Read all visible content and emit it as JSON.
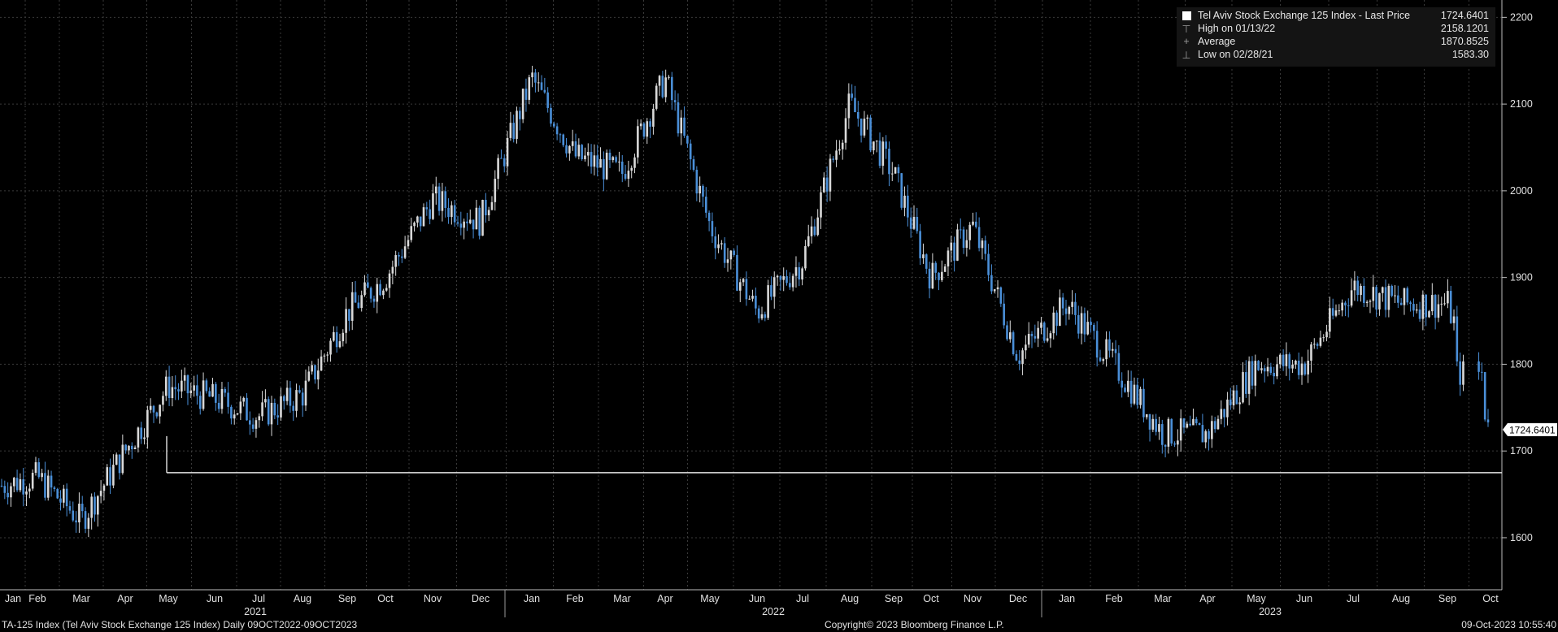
{
  "chart_data": {
    "type": "candlestick",
    "title": "TA-125 Index (Tel Aviv Stock Exchange 125 Index)",
    "frequency": "Daily",
    "date_range": "09OCT2022-09OCT2023",
    "ylim": [
      1540,
      2220
    ],
    "yticks": [
      1600,
      1700,
      1800,
      1900,
      2000,
      2100,
      2200
    ],
    "grid": true,
    "x_months": [
      "Jan",
      "Feb",
      "Mar",
      "Apr",
      "May",
      "Jun",
      "Jul",
      "Aug",
      "Sep",
      "Oct",
      "Nov",
      "Dec",
      "Jan",
      "Feb",
      "Mar",
      "Apr",
      "May",
      "Jun",
      "Jul",
      "Aug",
      "Sep",
      "Oct",
      "Nov",
      "Dec",
      "Jan",
      "Feb",
      "Mar",
      "Apr",
      "May",
      "Jun",
      "Jul",
      "Aug",
      "Sep",
      "Oct"
    ],
    "x_years": [
      "2021",
      "2022",
      "2023"
    ],
    "series": [
      {
        "name": "Tel Aviv Stock Exchange 125 Index - Last Price",
        "last_value": 1724.6401,
        "last_label": "1724.6401",
        "monthly_path": [
          [
            "Jan 2021",
            1660
          ],
          [
            "Feb 2021",
            1670
          ],
          [
            "Mar 2021",
            1620
          ],
          [
            "Apr 2021",
            1700
          ],
          [
            "May 2021",
            1775
          ],
          [
            "Jun 2021",
            1760
          ],
          [
            "Jul 2021",
            1740
          ],
          [
            "Aug 2021",
            1765
          ],
          [
            "Sep 2021",
            1860
          ],
          [
            "Oct 2021",
            1900
          ],
          [
            "Nov 2021",
            1990
          ],
          [
            "Dec 2021",
            1965
          ],
          [
            "Jan 2022",
            2130
          ],
          [
            "Feb 2022",
            2040
          ],
          [
            "Mar 2022",
            2020
          ],
          [
            "Apr 2022",
            2130
          ],
          [
            "May 2022",
            1960
          ],
          [
            "Jun 2022",
            1860
          ],
          [
            "Jul 2022",
            1920
          ],
          [
            "Aug 2022",
            2100
          ],
          [
            "Sep 2022",
            2020
          ],
          [
            "Oct 2022",
            1900
          ],
          [
            "Nov 2022",
            1960
          ],
          [
            "Dec 2022",
            1810
          ],
          [
            "Jan 2023",
            1870
          ],
          [
            "Feb 2023",
            1800
          ],
          [
            "Mar 2023",
            1720
          ],
          [
            "Apr 2023",
            1720
          ],
          [
            "May 2023",
            1800
          ],
          [
            "Jun 2023",
            1800
          ],
          [
            "Jul 2023",
            1890
          ],
          [
            "Aug 2023",
            1870
          ],
          [
            "Sep 2023",
            1870
          ],
          [
            "Oct 2023",
            1724.6401
          ]
        ]
      }
    ],
    "reference_line": {
      "value": 1675
    },
    "legend": {
      "title": "Tel Aviv Stock Exchange 125 Index - Last Price",
      "title_value": "1724.6401",
      "rows": [
        {
          "label": "High on 01/13/22",
          "value": "2158.1201"
        },
        {
          "label": "Average",
          "value": "1870.8525"
        },
        {
          "label": "Low on 02/28/21",
          "value": "1583.30"
        }
      ]
    },
    "colors": {
      "up": "#d9d9d9",
      "down": "#4a8fd8",
      "grid": "#3a3a3a",
      "background": "#000000"
    }
  },
  "footer": {
    "left": "TA-125 Index (Tel Aviv Stock Exchange 125 Index)  Daily 09OCT2022-09OCT2023",
    "center": "Copyright© 2023 Bloomberg Finance L.P.",
    "right": "09-Oct-2023 10:55:40"
  }
}
